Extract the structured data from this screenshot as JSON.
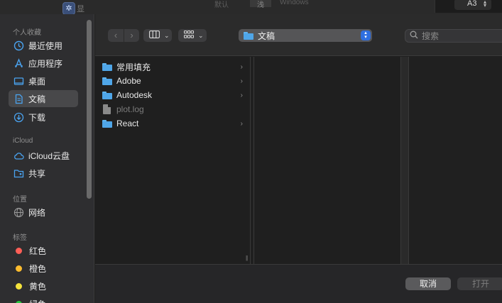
{
  "background_app": {
    "icon": "gear-app-icon",
    "title_cut": "显",
    "segment_labels": [
      "默认",
      "浅",
      "Windows"
    ],
    "paper_size": "A3"
  },
  "sidebar": {
    "sections": [
      {
        "header": "个人收藏",
        "items": [
          {
            "label": "最近使用",
            "icon": "clock-icon"
          },
          {
            "label": "应用程序",
            "icon": "applications-icon"
          },
          {
            "label": "桌面",
            "icon": "desktop-icon"
          },
          {
            "label": "文稿",
            "icon": "document-icon",
            "selected": true
          },
          {
            "label": "下载",
            "icon": "download-icon"
          }
        ]
      },
      {
        "header": "iCloud",
        "items": [
          {
            "label": "iCloud云盘",
            "icon": "cloud-icon"
          },
          {
            "label": "共享",
            "icon": "shared-folder-icon"
          }
        ]
      },
      {
        "header": "位置",
        "items": [
          {
            "label": "网络",
            "icon": "globe-icon"
          }
        ]
      },
      {
        "header": "标签",
        "items": [
          {
            "label": "红色",
            "color": "#ff5f57"
          },
          {
            "label": "橙色",
            "color": "#febc2e"
          },
          {
            "label": "黄色",
            "color": "#f5e33c"
          },
          {
            "label": "绿色",
            "color": "#28c840"
          }
        ]
      }
    ]
  },
  "toolbar": {
    "back_glyph": "‹",
    "forward_glyph": "›",
    "path_label": "文稿",
    "search_placeholder": "搜索"
  },
  "browser": {
    "column1": [
      {
        "name": "常用填充",
        "kind": "folder",
        "has_children": true
      },
      {
        "name": "Adobe",
        "kind": "folder",
        "has_children": true
      },
      {
        "name": "Autodesk",
        "kind": "folder",
        "has_children": true
      },
      {
        "name": "plot.log",
        "kind": "file",
        "disabled": true
      },
      {
        "name": "React",
        "kind": "folder",
        "has_children": true
      }
    ]
  },
  "footer": {
    "cancel_label": "取消",
    "open_label": "打开"
  }
}
